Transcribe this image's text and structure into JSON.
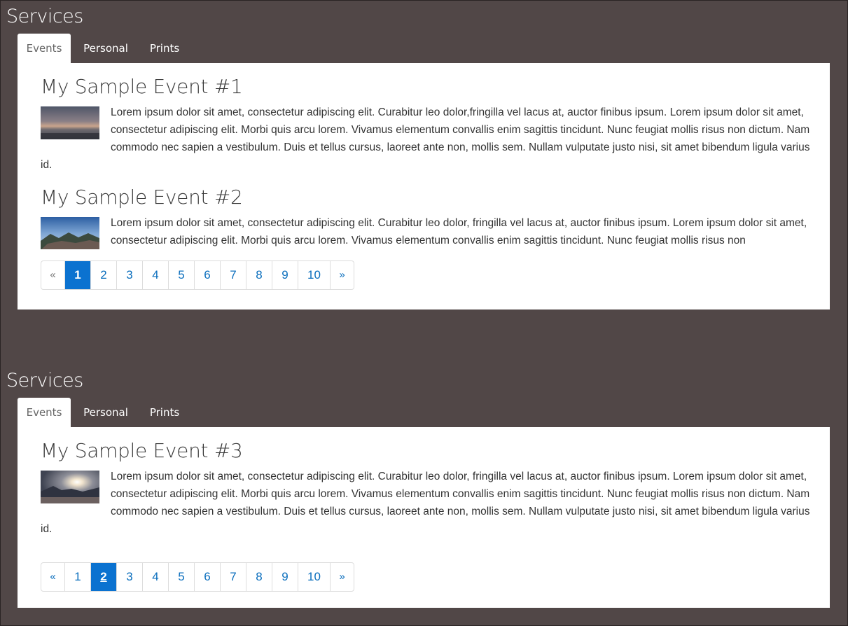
{
  "sections": [
    {
      "title": "Services",
      "tabs": [
        {
          "label": "Events",
          "active": true
        },
        {
          "label": "Personal",
          "active": false
        },
        {
          "label": "Prints",
          "active": false
        }
      ],
      "events": [
        {
          "title": "My Sample Event #1",
          "text": "Lorem ipsum dolor sit amet, consectetur adipiscing elit. Curabitur leo dolor,fringilla vel lacus at, auctor finibus ipsum. Lorem ipsum dolor sit amet, consectetur adipiscing elit. Morbi quis arcu lorem. Vivamus elementum convallis enim sagittis tincidunt. Nunc feugiat mollis risus non dictum. Nam commodo nec sapien a vestibulum. Duis et tellus cursus, laoreet ante non, mollis sem. Nullam vulputate justo nisi, sit amet bibendum ligula varius id."
        },
        {
          "title": "My Sample Event #2",
          "text": "Lorem ipsum dolor sit amet, consectetur adipiscing elit. Curabitur leo dolor, fringilla vel lacus at, auctor finibus ipsum. Lorem ipsum dolor sit amet, consectetur adipiscing elit. Morbi quis arcu lorem. Vivamus elementum convallis enim sagittis tincidunt. Nunc feugiat mollis risus non"
        }
      ],
      "pagination": {
        "prev": "«",
        "next": "»",
        "pages": [
          "1",
          "2",
          "3",
          "4",
          "5",
          "6",
          "7",
          "8",
          "9",
          "10"
        ],
        "current": "1"
      }
    },
    {
      "title": "Services",
      "tabs": [
        {
          "label": "Events",
          "active": true
        },
        {
          "label": "Personal",
          "active": false
        },
        {
          "label": "Prints",
          "active": false
        }
      ],
      "events": [
        {
          "title": "My Sample Event #3",
          "text": "Lorem ipsum dolor sit amet, consectetur adipiscing elit. Curabitur leo dolor, fringilla vel lacus at, auctor finibus ipsum. Lorem ipsum dolor sit amet, consectetur adipiscing elit. Morbi quis arcu lorem. Vivamus elementum convallis enim sagittis tincidunt. Nunc feugiat mollis risus non dictum. Nam commodo nec sapien a vestibulum. Duis et tellus cursus, laoreet ante non, mollis sem. Nullam vulputate justo nisi, sit amet bibendum ligula varius id."
        }
      ],
      "pagination": {
        "prev": "«",
        "next": "»",
        "pages": [
          "1",
          "2",
          "3",
          "4",
          "5",
          "6",
          "7",
          "8",
          "9",
          "10"
        ],
        "current": "2"
      }
    }
  ],
  "colors": {
    "background": "#514747",
    "accent": "#0b72d0",
    "link": "#0a6ebd"
  },
  "icons": {
    "thumbnail_1": "sunset-sea-photo",
    "thumbnail_2": "mountain-town-photo",
    "thumbnail_3": "sun-over-bay-photo"
  }
}
